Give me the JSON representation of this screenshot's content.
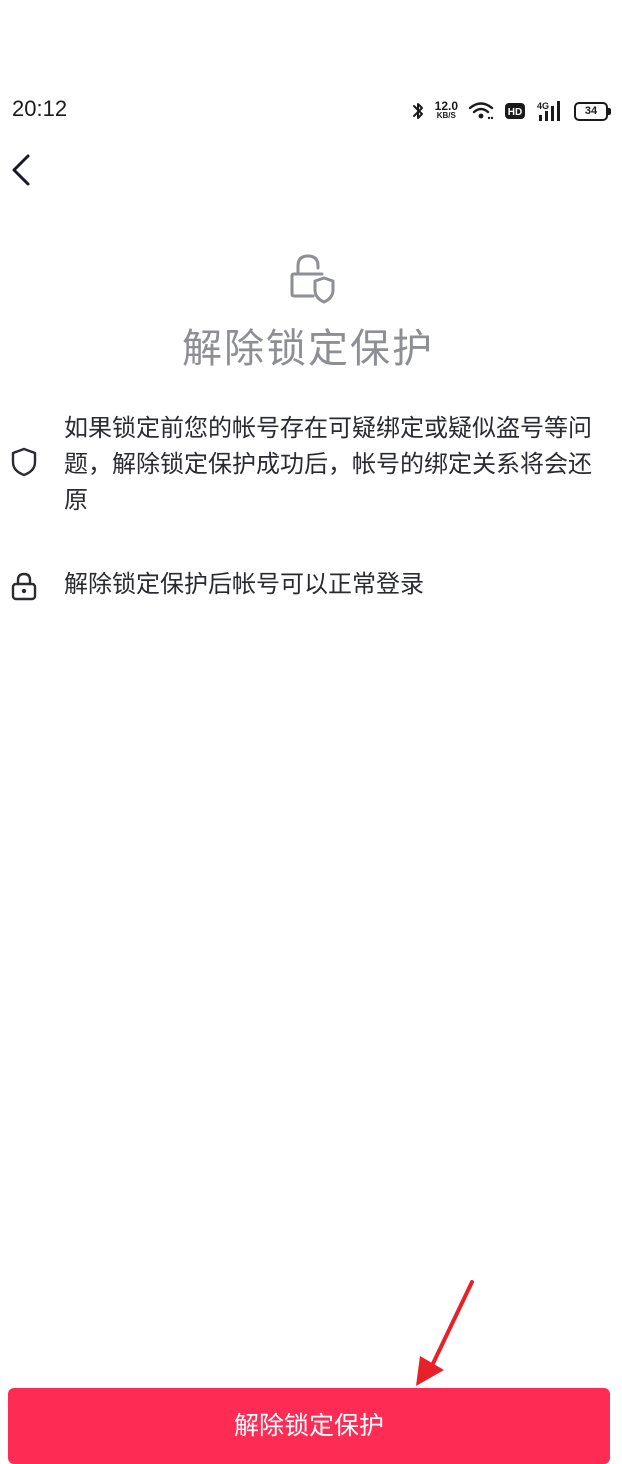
{
  "status_bar": {
    "time": "20:12",
    "net_speed_value": "12.0",
    "net_speed_unit": "KB/S",
    "hd_label": "HD",
    "network_type": "4G",
    "battery_level": "34",
    "icons": [
      "bluetooth-icon",
      "wifi-icon",
      "hd-icon",
      "cellular-signal-icon",
      "battery-icon"
    ]
  },
  "nav": {
    "back_icon": "chevron-left-icon"
  },
  "hero": {
    "icon": "lock-shield-icon",
    "title": "解除锁定保护"
  },
  "info_items": [
    {
      "icon": "shield-icon",
      "text": "如果锁定前您的帐号存在可疑绑定或疑似盗号等问题，解除锁定保护成功后，帐号的绑定关系将会还原"
    },
    {
      "icon": "lock-icon",
      "text": "解除锁定保护后帐号可以正常登录"
    }
  ],
  "action": {
    "button_label": "解除锁定保护"
  },
  "colors": {
    "accent": "#fe2c55",
    "annotation_arrow": "#e8202a",
    "title_gray": "#8e8f94",
    "body_text": "#2a2b30"
  }
}
